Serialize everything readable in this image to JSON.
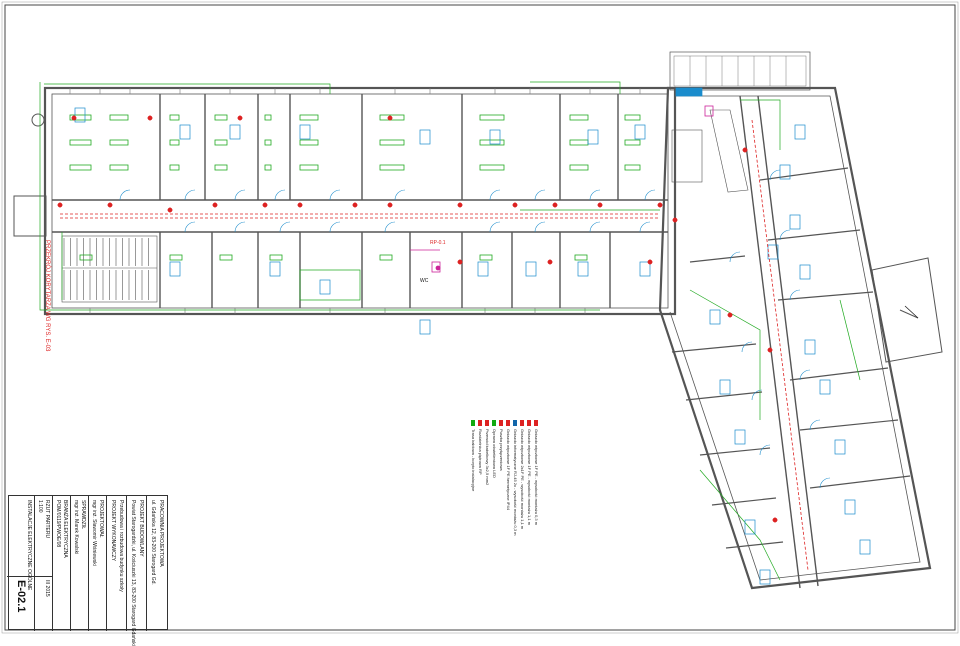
{
  "drawing": {
    "sheet_number": "E-02.1",
    "sheet_title": "INSTALACJE ELEKTRYCZNE OGÓLNE",
    "drawing_name": "RZUT PARTERU",
    "scale": "1:100",
    "date": "III 2015",
    "project": "PROJEKT BUDOWLANY",
    "phase": "PROJEKT WYKONAWCZY",
    "discipline": "BRANŻA ELEKTRYCZNA",
    "investor_line": "Powiat Starogardzki, ul. Kościuszki 13, 83-200 Starogard Gdański",
    "object_line": "Przebudowa i rozbudowa budynku szkoły",
    "designer_label": "PROJEKTOWAŁ",
    "designer_name": "mgr inż. Sławomir Wiśniewski",
    "checker_label": "SPRAWDZIŁ",
    "checker_name": "mgr inż. Marek Kowalski",
    "company": "PRACOWNIA PROJEKTOWA",
    "company_addr": "ul. Gdańska 12, 83-200 Starogard Gd.",
    "rev_label": "NR UPRAWNIEŃ",
    "rev_value": "POM/0119/PWOE/08",
    "sheet_label": "NR RYSUNKU"
  },
  "legend": {
    "rows": [
      {
        "text": "Gniazdo wtyczkowe 1F PE - wysokość montażu 0,3 m",
        "color": "#d22"
      },
      {
        "text": "Gniazdo wtyczkowe 1F PE - wysokość montażu 1,1 m",
        "color": "#d22"
      },
      {
        "text": "Gniazdo wtyczkowe 2x1F PE - wysokość montażu 1,1 m",
        "color": "#d22"
      },
      {
        "text": "Gniazdo informatyczne RJ-45 2x - wysokość montażu 0,3 m",
        "color": "#16a"
      },
      {
        "text": "Gniazdo wtyczkowe 1F PE hermetyczne IP44",
        "color": "#d22"
      },
      {
        "text": "Puszka przyłączeniowa",
        "color": "#d22"
      },
      {
        "text": "Oprawa oświetleniowa LED",
        "color": "#1a1"
      },
      {
        "text": "Przewód kabelkowy 3x2,5 mm2",
        "color": "#d22"
      },
      {
        "text": "Rozdzielnica piętrowa RP",
        "color": "#d22"
      },
      {
        "text": "Trasa kablowa - koryto instalacyjne",
        "color": "#1a1"
      }
    ]
  },
  "labels": {
    "corridor_note": "PRZEKRÓJ KORYTARZA WG RYS. E-03",
    "rp_tag": "RP-0.1",
    "wc_tag": "WC"
  },
  "colors": {
    "walls": "#555555",
    "power": "#dd2222",
    "data": "#1a8ccc",
    "lighting": "#22aa22",
    "magenta": "#cc2299"
  }
}
